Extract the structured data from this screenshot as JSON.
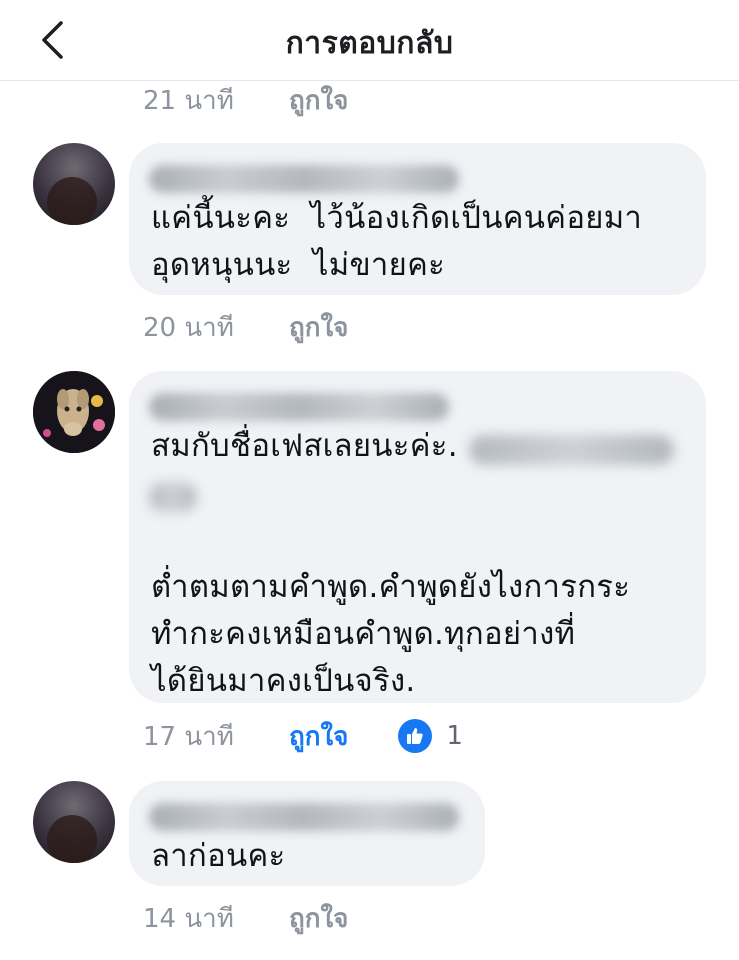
{
  "header": {
    "title": "การตอบกลับ",
    "back_icon": "chevron-left-icon"
  },
  "colors": {
    "accent": "#1877f2",
    "bubble": "#f0f2f5",
    "meta_text": "#8d949e"
  },
  "top_meta": {
    "time": "21 นาที",
    "like": "ถูกใจ"
  },
  "comments": [
    {
      "lines": [
        "แค่นี้นะคะ  ไว้น้องเกิดเป็นคนค่อยมา",
        "อุดหนุนนะ  ไม่ขายคะ"
      ],
      "time": "20 นาที",
      "like": "ถูกใจ"
    },
    {
      "lines": [
        "สมกับชื่อเฟสเลยนะค่ะ.",
        "",
        "",
        "ต่ำตมตามคำพูด.คำพูดยังไงการกระ",
        "ทำกะคงเหมือนคำพูด.ทุกอย่างที่",
        "ได้ยินมาคงเป็นจริง."
      ],
      "time": "17 นาที",
      "like": "ถูกใจ",
      "reaction_count": "1",
      "reaction_icon": "thumbs-up-icon"
    },
    {
      "lines": [
        "ลาก่อนคะ"
      ],
      "time": "14 นาที",
      "like": "ถูกใจ"
    }
  ]
}
